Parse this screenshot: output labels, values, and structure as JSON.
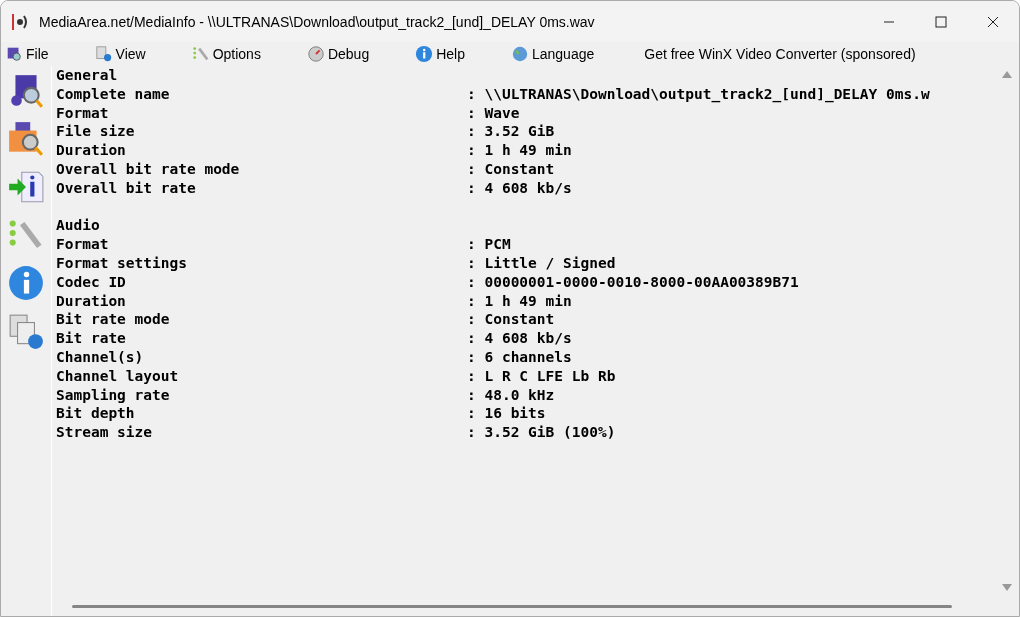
{
  "window": {
    "title": "MediaArea.net/MediaInfo - \\\\ULTRANAS\\Download\\output_track2_[und]_DELAY 0ms.wav"
  },
  "menu": [
    {
      "label": "File"
    },
    {
      "label": "View"
    },
    {
      "label": "Options"
    },
    {
      "label": "Debug"
    },
    {
      "label": "Help"
    },
    {
      "label": "Language"
    },
    {
      "label": "Get free WinX Video Converter (sponsored)"
    }
  ],
  "sections": [
    {
      "title": "General",
      "fields": [
        {
          "name": "Complete name",
          "separator": ":",
          "value": "\\\\ULTRANAS\\Download\\output_track2_[und]_DELAY 0ms.w"
        },
        {
          "name": "Format",
          "separator": ":",
          "value": "Wave"
        },
        {
          "name": "File size",
          "separator": ":",
          "value": "3.52 GiB"
        },
        {
          "name": "Duration",
          "separator": ":",
          "value": "1 h 49 min"
        },
        {
          "name": "Overall bit rate mode",
          "separator": ":",
          "value": "Constant"
        },
        {
          "name": "Overall bit rate",
          "separator": ":",
          "value": "4 608 kb/s"
        }
      ]
    },
    {
      "title": "Audio",
      "fields": [
        {
          "name": "Format",
          "separator": ":",
          "value": "PCM"
        },
        {
          "name": "Format settings",
          "separator": ":",
          "value": "Little / Signed"
        },
        {
          "name": "Codec ID",
          "separator": ":",
          "value": "00000001-0000-0010-8000-00AA00389B71"
        },
        {
          "name": "Duration",
          "separator": ":",
          "value": "1 h 49 min"
        },
        {
          "name": "Bit rate mode",
          "separator": ":",
          "value": "Constant"
        },
        {
          "name": "Bit rate",
          "separator": ":",
          "value": "4 608 kb/s"
        },
        {
          "name": "Channel(s)",
          "separator": ":",
          "value": "6 channels"
        },
        {
          "name": "Channel layout",
          "separator": ":",
          "value": "L R C LFE Lb Rb"
        },
        {
          "name": "Sampling rate",
          "separator": ":",
          "value": "48.0 kHz"
        },
        {
          "name": "Bit depth",
          "separator": ":",
          "value": "16 bits"
        },
        {
          "name": "Stream size",
          "separator": ":",
          "value": "3.52 GiB (100%)"
        }
      ]
    }
  ]
}
